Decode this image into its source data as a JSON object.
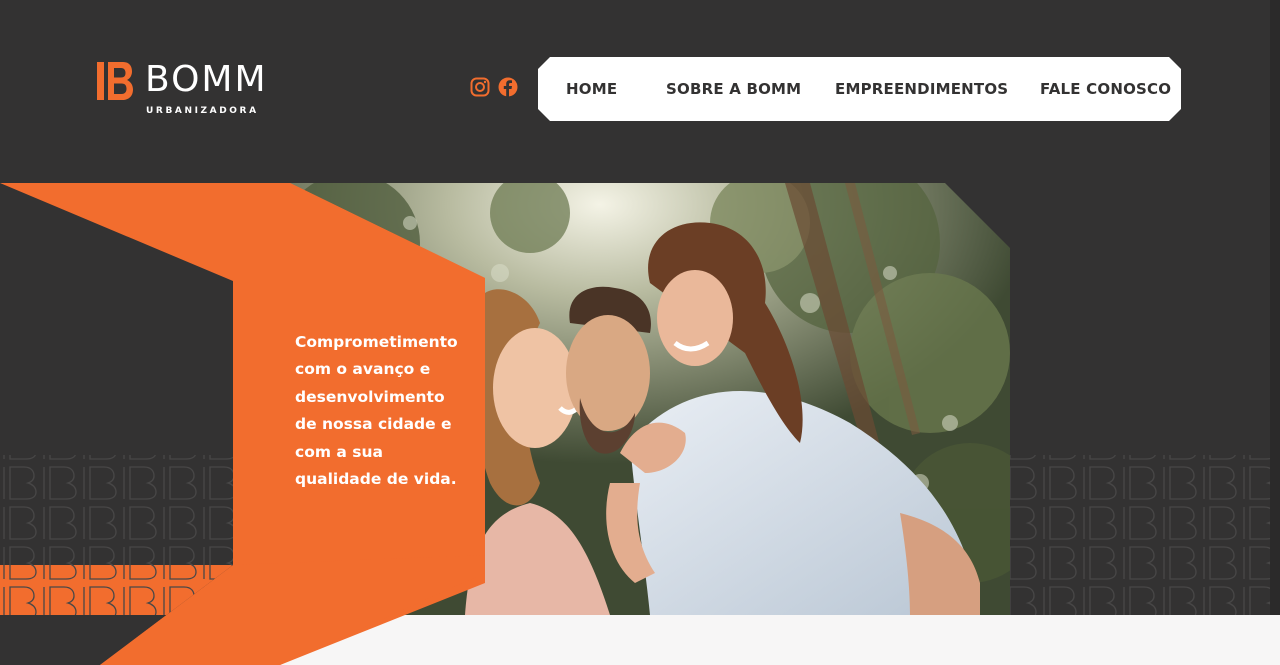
{
  "brand": {
    "name": "BOMM",
    "subtitle": "URBANIZADORA",
    "accent_color": "#f26d2e",
    "background_color": "#333232"
  },
  "social": [
    {
      "icon": "instagram-icon"
    },
    {
      "icon": "facebook-icon"
    }
  ],
  "nav": {
    "items": [
      {
        "label": "HOME"
      },
      {
        "label": "SOBRE A BOMM"
      },
      {
        "label": "EMPREENDIMENTOS"
      },
      {
        "label": "FALE CONOSCO"
      }
    ]
  },
  "hero": {
    "tagline_lines": [
      "Comprometimento",
      "com o avanço e",
      "desenvolvimento",
      "de nossa cidade e",
      "com a sua",
      "qualidade de vida."
    ]
  }
}
